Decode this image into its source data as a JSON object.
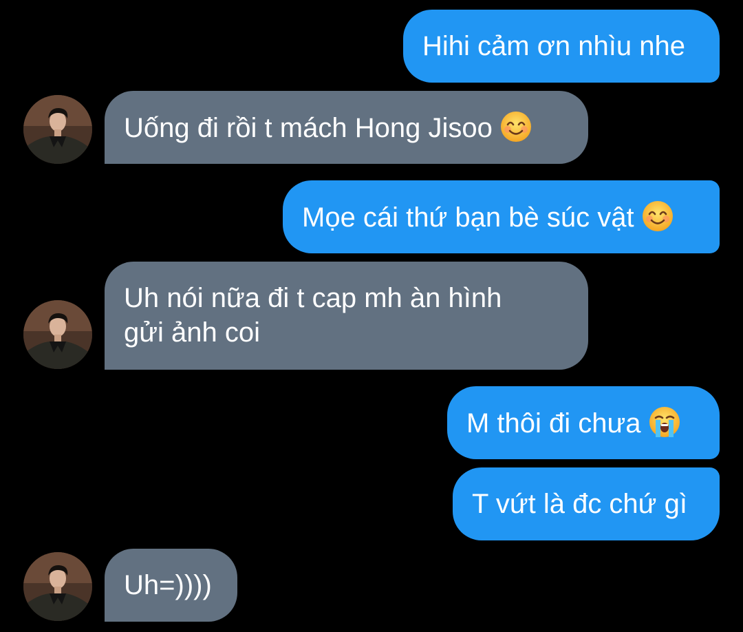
{
  "colors": {
    "background": "#000000",
    "sent_bubble": "#2196f3",
    "received_bubble": "#627181",
    "text": "#ffffff"
  },
  "messages": [
    {
      "side": "sent",
      "text": "Hihi cảm ơn nhìu nhe"
    },
    {
      "side": "received",
      "text": "Uống đi rồi t mách Hong Jisoo",
      "emoji": "smiling-face-icon"
    },
    {
      "side": "sent",
      "text": "Mọe cái thứ bạn bè súc vật",
      "emoji": "smiling-face-icon"
    },
    {
      "side": "received",
      "lines": [
        "Uh nói nữa đi t cap mh àn hình",
        "gửi ảnh coi"
      ]
    },
    {
      "side": "sent",
      "text": "M thôi đi chưa",
      "emoji": "loudly-crying-face-icon"
    },
    {
      "side": "sent",
      "text": "T vứt là đc chứ gì"
    },
    {
      "side": "received",
      "text": "Uh=))))"
    }
  ]
}
